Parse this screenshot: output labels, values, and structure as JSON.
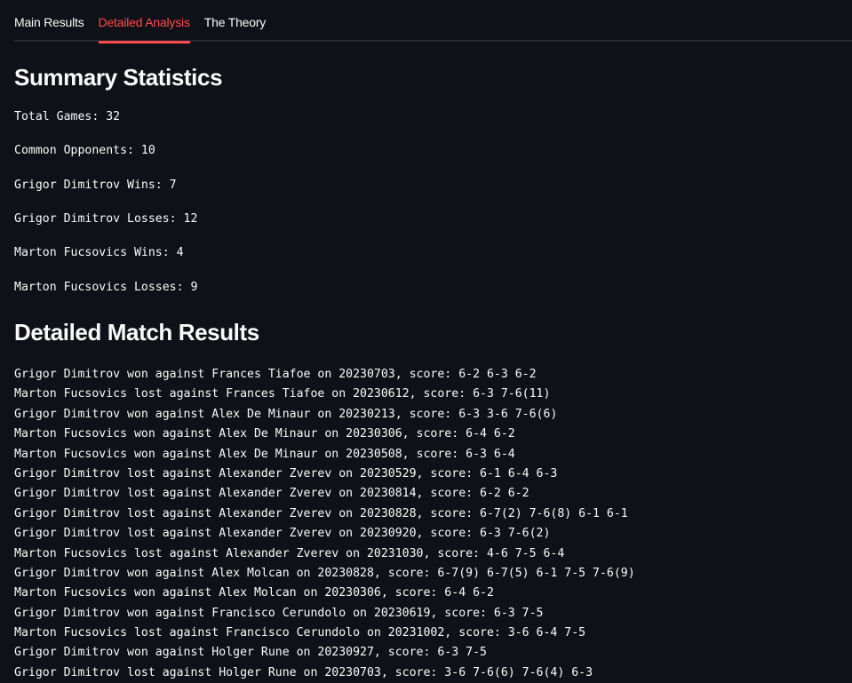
{
  "tabs": [
    {
      "label": "Main Results",
      "active": false
    },
    {
      "label": "Detailed Analysis",
      "active": true
    },
    {
      "label": "The Theory",
      "active": false
    }
  ],
  "colors": {
    "background": "#0e1117",
    "accent": "#ff4b4b",
    "text": "#fafafa"
  },
  "summary": {
    "title": "Summary Statistics",
    "stats": [
      "Total Games: 32",
      "Common Opponents: 10",
      "Grigor Dimitrov Wins: 7",
      "Grigor Dimitrov Losses: 12",
      "Marton Fucsovics Wins: 4",
      "Marton Fucsovics Losses: 9"
    ]
  },
  "details": {
    "title": "Detailed Match Results",
    "results": [
      "Grigor Dimitrov won against Frances Tiafoe on 20230703, score: 6-2 6-3 6-2",
      "Marton Fucsovics lost against Frances Tiafoe on 20230612, score: 6-3 7-6(11)",
      "Grigor Dimitrov won against Alex De Minaur on 20230213, score: 6-3 3-6 7-6(6)",
      "Marton Fucsovics won against Alex De Minaur on 20230306, score: 6-4 6-2",
      "Marton Fucsovics won against Alex De Minaur on 20230508, score: 6-3 6-4",
      "Grigor Dimitrov lost against Alexander Zverev on 20230529, score: 6-1 6-4 6-3",
      "Grigor Dimitrov lost against Alexander Zverev on 20230814, score: 6-2 6-2",
      "Grigor Dimitrov lost against Alexander Zverev on 20230828, score: 6-7(2) 7-6(8) 6-1 6-1",
      "Grigor Dimitrov lost against Alexander Zverev on 20230920, score: 6-3 7-6(2)",
      "Marton Fucsovics lost against Alexander Zverev on 20231030, score: 4-6 7-5 6-4",
      "Grigor Dimitrov won against Alex Molcan on 20230828, score: 6-7(9) 6-7(5) 6-1 7-5 7-6(9)",
      "Marton Fucsovics won against Alex Molcan on 20230306, score: 6-4 6-2",
      "Grigor Dimitrov won against Francisco Cerundolo on 20230619, score: 6-3 7-5",
      "Marton Fucsovics lost against Francisco Cerundolo on 20231002, score: 3-6 6-4 7-5",
      "Grigor Dimitrov won against Holger Rune on 20230927, score: 6-3 7-5",
      "Grigor Dimitrov lost against Holger Rune on 20230703, score: 3-6 7-6(6) 7-6(4) 6-3"
    ]
  }
}
